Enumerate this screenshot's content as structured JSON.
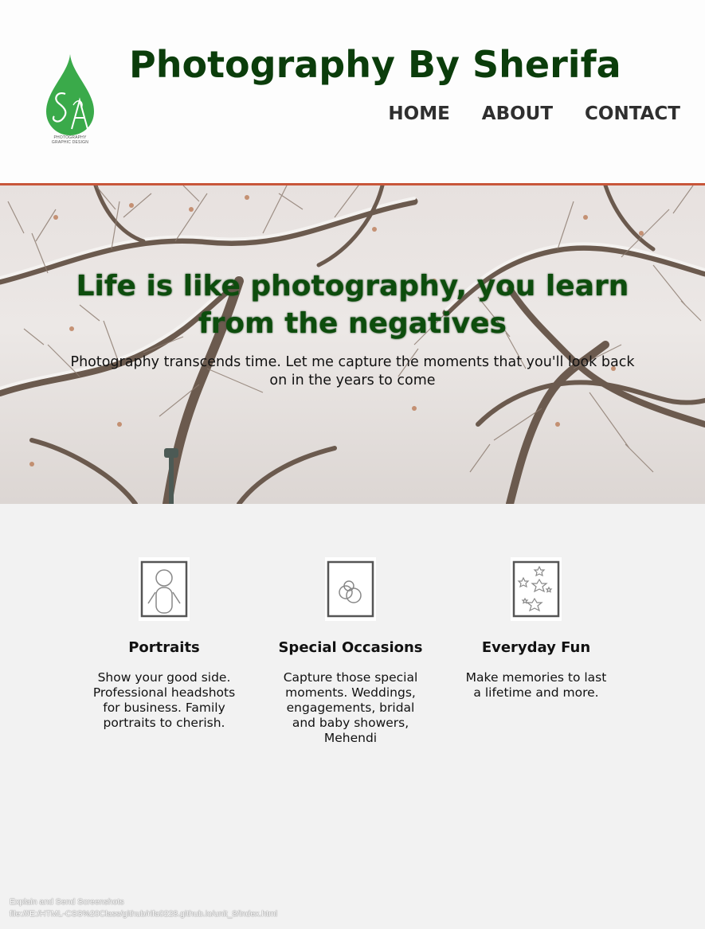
{
  "header": {
    "logo_monogram": "SA",
    "logo_caption_line1": "PHOTOGRAPHY",
    "logo_caption_line2": "GRAPHIC DESIGN",
    "site_title": "Photography By Sherifa",
    "nav": [
      {
        "label": "HOME"
      },
      {
        "label": "ABOUT"
      },
      {
        "label": "CONTACT"
      }
    ]
  },
  "hero": {
    "quote": "Life is like photography, you learn from the negatives",
    "subtitle": "Photography transcends time. Let me capture the moments that you'll look back on in the years to come"
  },
  "services": [
    {
      "icon": "portrait-icon",
      "title": "Portraits",
      "description": "Show your good side. Professional headshots for business. Family portraits to cherish."
    },
    {
      "icon": "rings-icon",
      "title": "Special Occasions",
      "description": "Capture those special moments. Weddings, engagements, bridal and baby showers, Mehendi"
    },
    {
      "icon": "stars-icon",
      "title": "Everyday Fun",
      "description": "Make memories to last a lifetime and more."
    }
  ],
  "browser_status": {
    "line1": "Explain and Send Screenshots",
    "line2": "file:///E:/HTML-CSS%20Class/github/rifa0228.github.io/unit_8/index.html"
  },
  "colors": {
    "title_green": "#0b3d0b",
    "logo_green": "#3aaa4a",
    "accent_rule": "#c8563a",
    "background": "#f2f2f2"
  }
}
